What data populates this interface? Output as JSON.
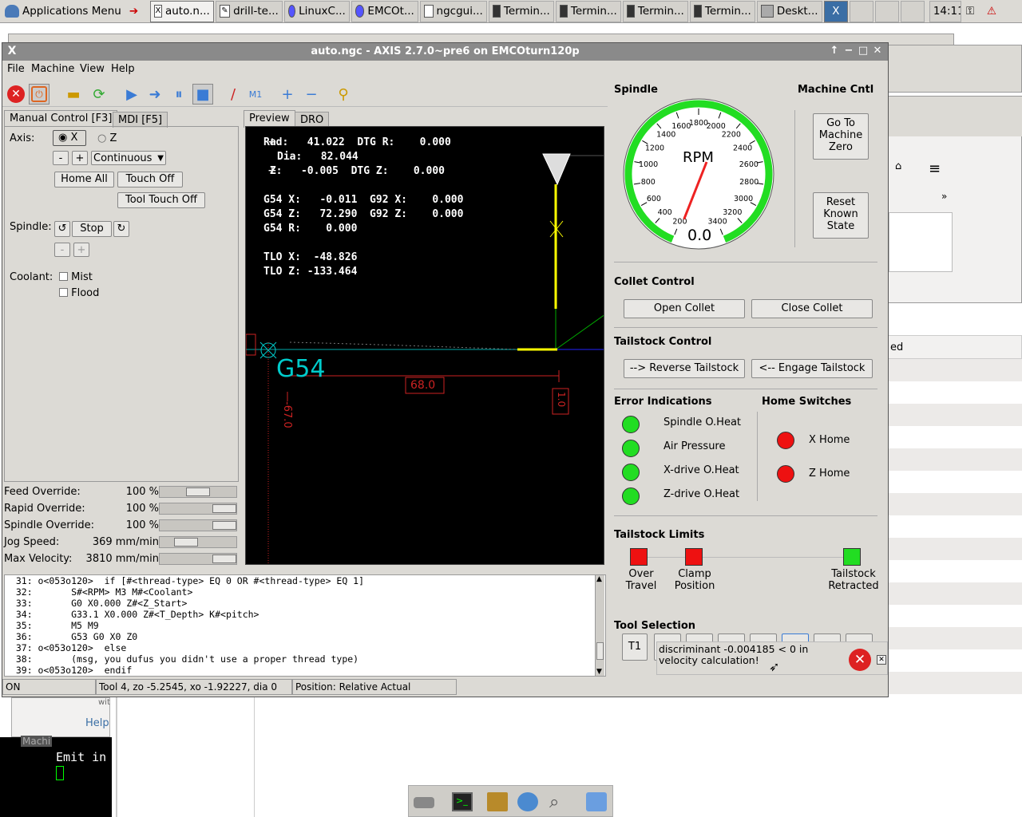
{
  "taskbar": {
    "apps_label": "Applications Menu",
    "items": [
      "auto.n...",
      "drill-te...",
      "LinuxC...",
      "EMCOt...",
      "ngcgui...",
      "Termin...",
      "Termin...",
      "Termin...",
      "Termin...",
      "Deskt..."
    ],
    "clock": "14:11"
  },
  "window": {
    "title": "auto.ngc - AXIS 2.7.0~pre6 on EMCOturn120p"
  },
  "menu": [
    "File",
    "Machine",
    "View",
    "Help"
  ],
  "tabs": {
    "manual": "Manual Control [F3]",
    "mdi": "MDI [F5]",
    "preview": "Preview",
    "dro": "DRO"
  },
  "manual": {
    "axis_label": "Axis:",
    "axis_x": "X",
    "axis_z": "Z",
    "minus": "-",
    "plus": "+",
    "jog_mode": "Continuous",
    "home_all": "Home All",
    "touch_off": "Touch Off",
    "tool_touch_off": "Tool Touch Off",
    "spindle_label": "Spindle:",
    "stop": "Stop",
    "coolant_label": "Coolant:",
    "mist": "Mist",
    "flood": "Flood"
  },
  "overrides": [
    {
      "label": "Feed Override:",
      "value": "100 %",
      "level": 0.5
    },
    {
      "label": "Rapid Override:",
      "value": "100 %",
      "level": 1.0
    },
    {
      "label": "Spindle Override:",
      "value": "100 %",
      "level": 1.0
    },
    {
      "label": "Jog Speed:",
      "value": "369 mm/min",
      "level": 0.27
    },
    {
      "label": "Max Velocity:",
      "value": "3810 mm/min",
      "level": 1.0
    }
  ],
  "dro": {
    "lines": [
      "Rad:   41.022  DTG R:    0.000",
      "Dia:   82.044",
      " Z:   -0.005  DTG Z:    0.000",
      "",
      "G54 X:   -0.011  G92 X:    0.000",
      "G54 Z:   72.290  G92 Z:    0.000",
      "G54 R:    0.000",
      "",
      "TLO X:  -48.826",
      "TLO Z: -133.464"
    ],
    "g54": "G54",
    "dim_68": "68.0",
    "dim_1": "1.0",
    "dim_67": "-67.0"
  },
  "code": [
    "  31: o<053o120>  if [#<thread-type> EQ 0 OR #<thread-type> EQ 1]",
    "  32:       S#<RPM> M3 M#<Coolant>",
    "  33:       G0 X0.000 Z#<Z_Start>",
    "  34:       G33.1 X0.000 Z#<T_Depth> K#<pitch>",
    "  35:       M5 M9",
    "  36:       G53 G0 X0 Z0",
    "  37: o<053o120>  else",
    "  38:       (msg, you dufus you didn't use a proper thread type)",
    "  39: o<053o120>  endif"
  ],
  "status": {
    "state": "ON",
    "tool": "Tool 4, zo -5.2545, xo -1.92227, dia 0",
    "position": "Position: Relative Actual"
  },
  "spindle": {
    "title": "Spindle",
    "machine_title": "Machine Cntl",
    "rpm_label": "RPM",
    "rpm_value": "0.0",
    "ticks": [
      "200",
      "400",
      "600",
      "800",
      "1000",
      "1200",
      "1400",
      "1600",
      "1800",
      "2000",
      "2200",
      "2400",
      "2600",
      "2800",
      "3000",
      "3200",
      "3400"
    ],
    "goto_zero": "Go To Machine Zero",
    "reset": "Reset Known State"
  },
  "collet": {
    "title": "Collet Control",
    "open": "Open Collet",
    "close": "Close Collet"
  },
  "tailstock": {
    "title": "Tailstock Control",
    "reverse": "--> Reverse Tailstock",
    "engage": "<-- Engage Tailstock"
  },
  "errors": {
    "title": "Error Indications",
    "items": [
      "Spindle O.Heat",
      "Air Pressure",
      "X-drive O.Heat",
      "Z-drive O.Heat"
    ],
    "color": "#22dd22"
  },
  "home": {
    "title": "Home Switches",
    "items": [
      "X Home",
      "Z Home"
    ],
    "color": "#ee1111"
  },
  "limits": {
    "title": "Tailstock Limits",
    "over": "Over Travel",
    "clamp": "Clamp Position",
    "retracted": "Tailstock Retracted"
  },
  "tool_sel": {
    "title": "Tool Selection",
    "t1": "T1"
  },
  "error_popup": {
    "message": "discriminant -0.004185 < 0 in velocity calculation!"
  },
  "bg": {
    "help": "Help",
    "emit": "Emit in",
    "ed": "ed",
    "machi": "Machi",
    "wi": "wit"
  }
}
